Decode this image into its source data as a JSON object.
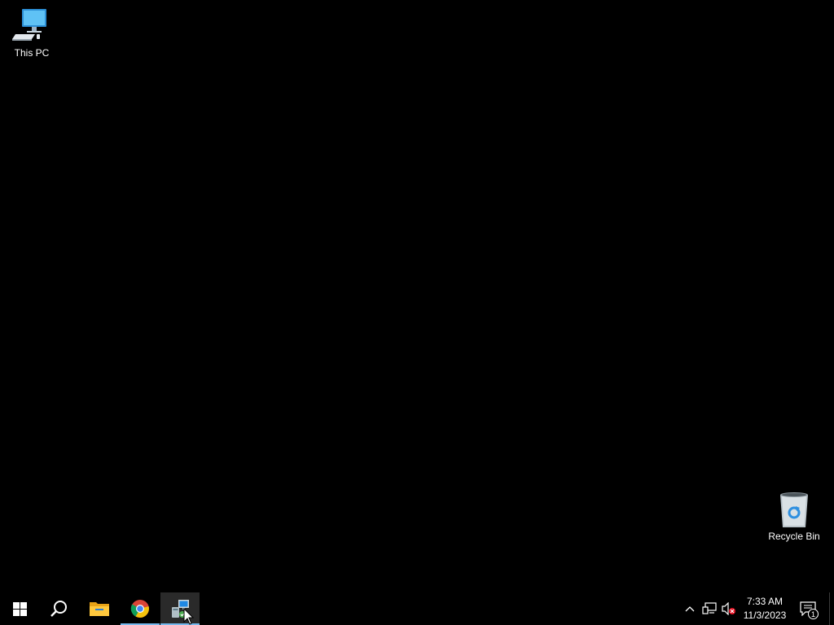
{
  "desktop": {
    "background_color": "#000000",
    "icons": [
      {
        "label": "This PC",
        "icon": "this-pc-icon"
      },
      {
        "label": "Recycle Bin",
        "icon": "recycle-bin-icon"
      }
    ]
  },
  "taskbar": {
    "background_color": "#000000",
    "accent_color": "#76b9ed",
    "buttons": [
      {
        "icon": "windows-start-icon"
      },
      {
        "icon": "search-icon"
      },
      {
        "icon": "file-explorer-icon"
      },
      {
        "icon": "chrome-icon",
        "running": true
      },
      {
        "icon": "installer-app-icon",
        "running": true,
        "active": true
      }
    ],
    "tray": {
      "icons": [
        "chevron-up-icon",
        "network-icon",
        "volume-muted-icon"
      ],
      "time": "7:33 AM",
      "date": "11/3/2023",
      "notification_count": "1"
    }
  }
}
